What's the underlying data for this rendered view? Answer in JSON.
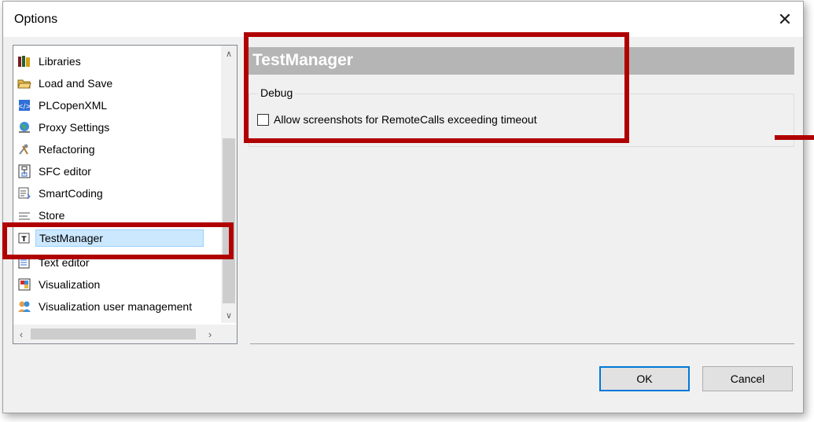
{
  "window": {
    "title": "Options",
    "close_glyph": "✕"
  },
  "tree": {
    "items": [
      {
        "label": "Libraries",
        "icon": "books-icon"
      },
      {
        "label": "Load and Save",
        "icon": "folder-open-icon"
      },
      {
        "label": "PLCopenXML",
        "icon": "xml-icon"
      },
      {
        "label": "Proxy Settings",
        "icon": "globe-icon"
      },
      {
        "label": "Refactoring",
        "icon": "tools-icon"
      },
      {
        "label": "SFC editor",
        "icon": "sfc-icon"
      },
      {
        "label": "SmartCoding",
        "icon": "smartcoding-icon"
      },
      {
        "label": "Store",
        "icon": "store-icon"
      },
      {
        "label": "TestManager",
        "icon": "testmanager-icon",
        "selected": true
      },
      {
        "label": "Text editor",
        "icon": "text-editor-icon"
      },
      {
        "label": "Visualization",
        "icon": "visualization-icon"
      },
      {
        "label": "Visualization user management",
        "icon": "users-icon"
      }
    ]
  },
  "content": {
    "title": "TestManager",
    "group_label": "Debug",
    "checkbox_label": "Allow screenshots for RemoteCalls exceeding timeout",
    "checkbox_checked": false
  },
  "buttons": {
    "ok": "OK",
    "cancel": "Cancel"
  },
  "colors": {
    "annotation": "#b00000",
    "header_bar": "#b5b5b5",
    "selection": "#cce8ff",
    "ok_border": "#0078d7"
  }
}
